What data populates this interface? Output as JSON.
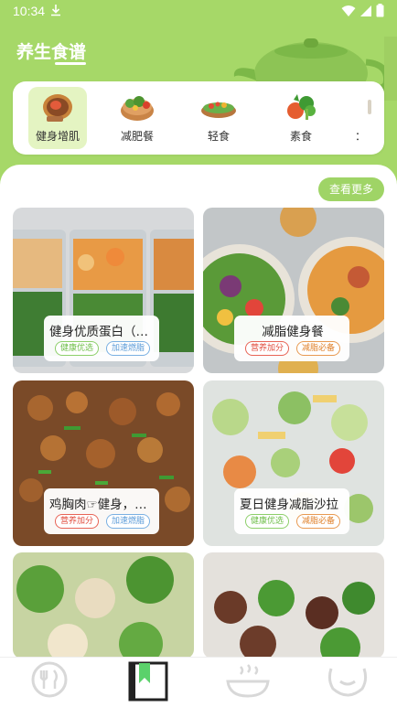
{
  "status_bar": {
    "time": "10:34"
  },
  "header": {
    "title": "养生食谱"
  },
  "categories": [
    {
      "label": "健身增肌",
      "icon": "fitness-dish-icon",
      "active": true
    },
    {
      "label": "减肥餐",
      "icon": "salad-bowl-icon",
      "active": false
    },
    {
      "label": "轻食",
      "icon": "light-meal-icon",
      "active": false
    },
    {
      "label": "素食",
      "icon": "vegetables-icon",
      "active": false
    },
    {
      "label": "：",
      "icon": "more-category-icon",
      "active": false
    }
  ],
  "more_button": "查看更多",
  "recipes": [
    {
      "title": "健身优质蛋白（肉...",
      "tags": [
        "健康优选",
        "加速燃脂"
      ]
    },
    {
      "title": "减脂健身餐",
      "tags": [
        "营养加分",
        "减脂必备"
      ]
    },
    {
      "title": "鸡胸肉☞健身，懒...",
      "tags": [
        "营养加分",
        "加速燃脂"
      ]
    },
    {
      "title": "夏日健身减脂沙拉",
      "tags": [
        "健康优选",
        "减脂必备"
      ]
    }
  ],
  "bottom_nav": [
    {
      "icon": "fork-knife-icon",
      "active": false
    },
    {
      "icon": "bookmark-icon",
      "active": true
    },
    {
      "icon": "bowl-icon",
      "active": false
    },
    {
      "icon": "smile-icon",
      "active": false
    }
  ],
  "colors": {
    "header_green": "#a6d868",
    "active_category_bg": "#e4f4c2",
    "button_green": "#9fd466",
    "tag_green": "#6fbf4a",
    "tag_blue": "#5b9bd8",
    "tag_red": "#e14a3b",
    "tag_orange": "#e0822c"
  }
}
